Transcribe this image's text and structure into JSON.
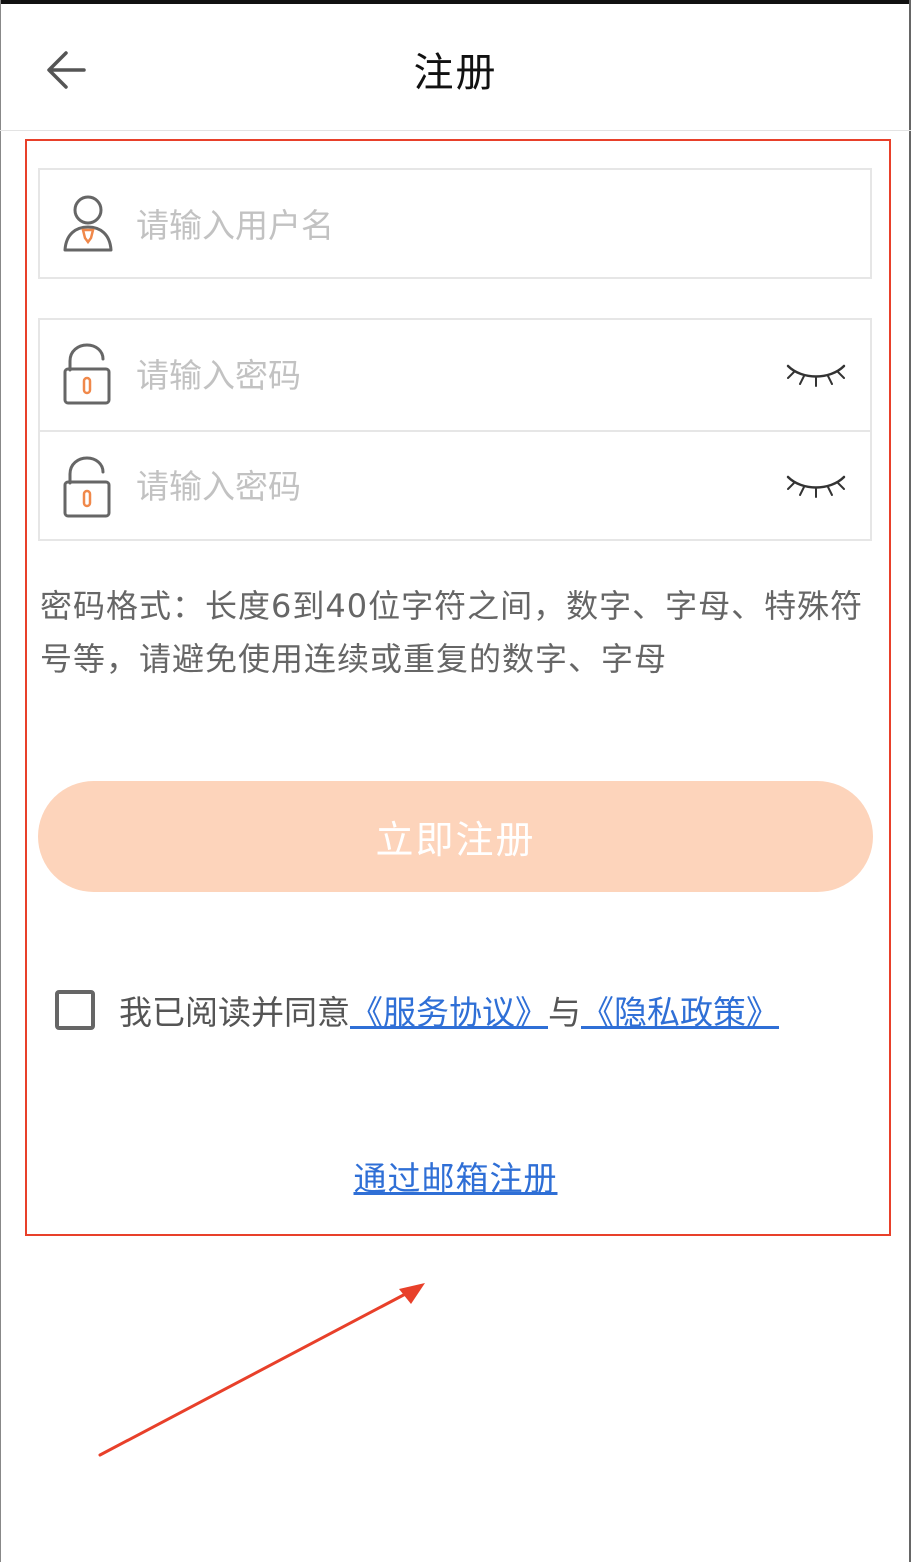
{
  "header": {
    "title": "注册",
    "back_icon": "arrow-left-icon"
  },
  "form": {
    "username": {
      "placeholder": "请输入用户名",
      "icon": "user-icon"
    },
    "password": {
      "placeholder": "请输入密码",
      "icon": "lock-icon",
      "toggle_icon": "eye-closed-icon"
    },
    "confirm_password": {
      "placeholder": "请输入密码",
      "icon": "lock-icon",
      "toggle_icon": "eye-closed-icon"
    },
    "hint": "密码格式：长度6到40位字符之间，数字、字母、特殊符号等，请避免使用连续或重复的数字、字母",
    "submit_label": "立即注册",
    "agreement": {
      "checked": false,
      "prefix": "我已阅读并同意",
      "service_link": "《服务协议》",
      "connector": "与",
      "privacy_link": "《隐私政策》"
    },
    "email_register_link": "通过邮箱注册"
  },
  "colors": {
    "accent": "#f0884a",
    "button_bg": "#fdd4bb",
    "link": "#2f6fd6",
    "annotation": "#e8402a"
  }
}
